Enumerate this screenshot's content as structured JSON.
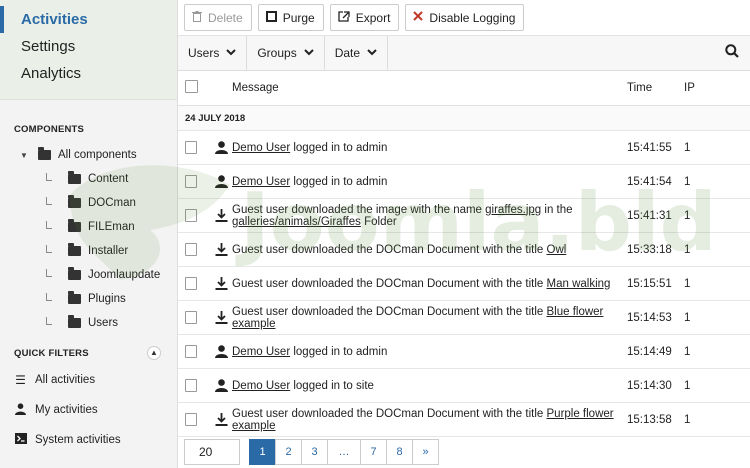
{
  "sidebar": {
    "nav": [
      "Activities",
      "Settings",
      "Analytics"
    ],
    "components_title": "COMPONENTS",
    "tree_root": "All components",
    "tree_children": [
      "Content",
      "DOCman",
      "FILEman",
      "Installer",
      "Joomlaupdate",
      "Plugins",
      "Users"
    ],
    "quick_filters_title": "QUICK FILTERS",
    "quick_filters": [
      "All activities",
      "My activities",
      "System activities"
    ]
  },
  "toolbar": {
    "delete": "Delete",
    "purge": "Purge",
    "export": "Export",
    "disable_logging": "Disable Logging"
  },
  "filters": {
    "users": "Users",
    "groups": "Groups",
    "date": "Date"
  },
  "table": {
    "headers": {
      "message": "Message",
      "time": "Time",
      "ip": "IP"
    },
    "date_group": "24 JULY 2018",
    "rows": [
      {
        "icon": "user-icon",
        "link": "Demo User",
        "text": " logged in to admin",
        "time": "15:41:55",
        "ip": "1"
      },
      {
        "icon": "user-icon",
        "link": "Demo User",
        "text": " logged in to admin",
        "time": "15:41:54",
        "ip": "1"
      },
      {
        "icon": "download-icon",
        "pre": "Guest user downloaded the image with the name ",
        "link": "giraffes.jpg",
        "mid": " in the ",
        "link2": "galleries/animals/Giraffes",
        "post": " Folder",
        "time": "15:41:31",
        "ip": "1"
      },
      {
        "icon": "download-icon",
        "pre": "Guest user downloaded the DOCman Document with the title ",
        "link": "Owl",
        "time": "15:33:18",
        "ip": "1"
      },
      {
        "icon": "download-icon",
        "pre": "Guest user downloaded the DOCman Document with the title ",
        "link": "Man walking",
        "time": "15:15:51",
        "ip": "1"
      },
      {
        "icon": "download-icon",
        "pre": "Guest user downloaded the DOCman Document with the title ",
        "link": "Blue flower example",
        "time": "15:14:53",
        "ip": "1"
      },
      {
        "icon": "user-icon",
        "link": "Demo User",
        "text": " logged in to admin",
        "time": "15:14:49",
        "ip": "1"
      },
      {
        "icon": "user-icon",
        "link": "Demo User",
        "text": " logged in to site",
        "time": "15:14:30",
        "ip": "1"
      },
      {
        "icon": "download-icon",
        "pre": "Guest user downloaded the DOCman Document with the title ",
        "link": "Purple flower example",
        "time": "15:13:58",
        "ip": "1"
      }
    ]
  },
  "pagination": {
    "limit": "20",
    "pages": [
      "1",
      "2",
      "3",
      "…",
      "7",
      "8",
      "»"
    ],
    "active": "1"
  },
  "watermark": "Joomla.bld",
  "colors": {
    "accent": "#2a6aa6",
    "watermark": "#5a8a3c"
  }
}
